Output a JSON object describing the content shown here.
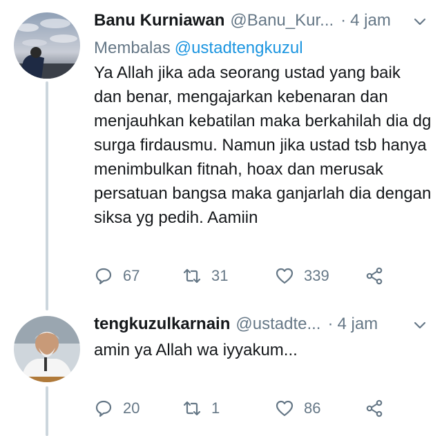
{
  "tweets": [
    {
      "name": "Banu Kurniawan",
      "handle": "@Banu_Kur...",
      "separator": "·",
      "time": "4 jam",
      "reply_prefix": "Membalas",
      "reply_to": "@ustadtengkuzul",
      "text": "Ya Allah jika ada seorang ustad yang baik dan benar, mengajarkan kebenaran dan menjauhkan kebatilan maka berkahilah dia dg surga firdausmu. Namun jika ustad tsb hanya menimbulkan fitnah, hoax dan merusak persatuan bangsa maka ganjarlah dia dengan siksa yg pedih. Aamiin",
      "replies": "67",
      "retweets": "31",
      "likes": "339"
    },
    {
      "name": "tengkuzulkarnain",
      "handle": "@ustadte...",
      "separator": "·",
      "time": "4 jam",
      "text": "amin ya Allah wa iyyakum...",
      "replies": "20",
      "retweets": "1",
      "likes": "86"
    }
  ],
  "colors": {
    "name": "#14171a",
    "muted": "#657786",
    "link": "#1b95e0",
    "thread_line": "#ccd6dd"
  },
  "icons": [
    "reply-icon",
    "retweet-icon",
    "like-icon",
    "share-icon",
    "chevron-down-icon"
  ]
}
